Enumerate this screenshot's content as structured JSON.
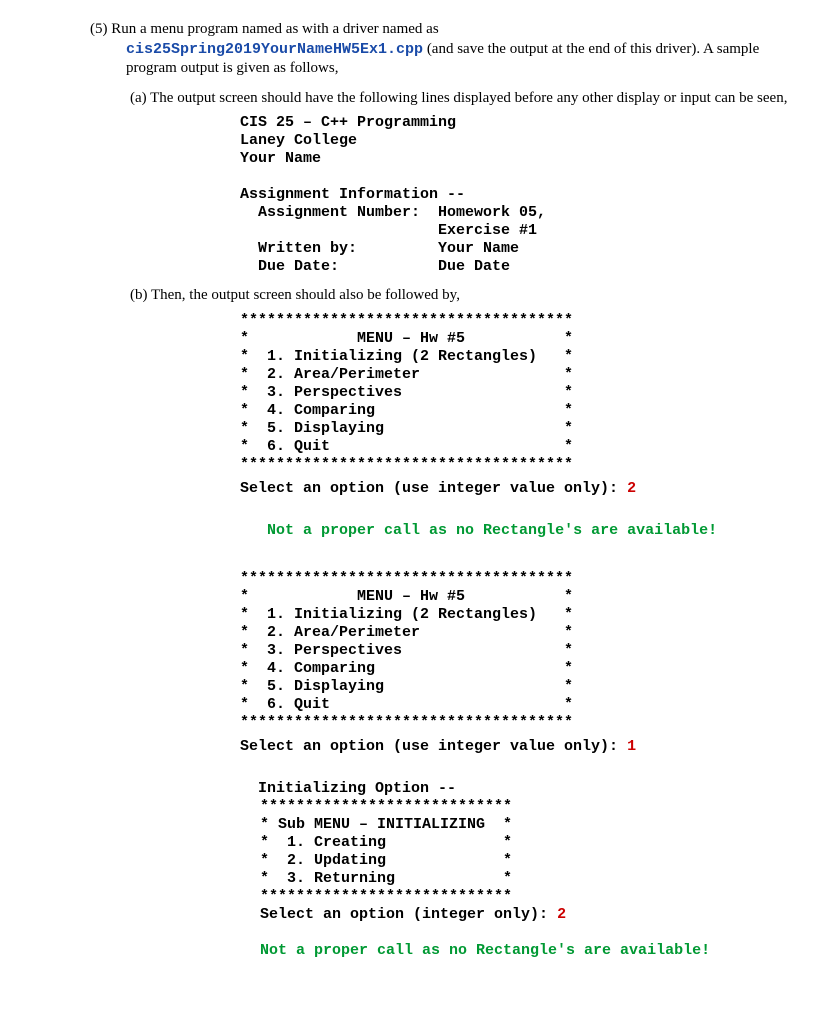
{
  "item5": {
    "label": "(5) ",
    "text1": "Run a menu program named as with a driver named as",
    "filename": "cis25Spring2019YourNameHW5Ex1.cpp",
    "text2": " (and save the output at the end of this driver). A sample program output is given as follows,"
  },
  "sub_a": {
    "label": "(a) ",
    "text": "The output screen should have the following lines displayed before any other display or input can be seen,",
    "output": "CIS 25 – C++ Programming\nLaney College\nYour Name\n\nAssignment Information --\n  Assignment Number:  Homework 05,\n                      Exercise #1\n  Written by:         Your Name\n  Due Date:           Due Date"
  },
  "sub_b": {
    "label": "(b) ",
    "text": "Then, the output screen should also be followed by,",
    "menu1": "*************************************\n*            MENU – Hw #5           *\n*  1. Initializing (2 Rectangles)   *\n*  2. Area/Perimeter                *\n*  3. Perspectives                  *\n*  4. Comparing                     *\n*  5. Displaying                    *\n*  6. Quit                          *\n*************************************",
    "prompt1": "Select an option (use integer value only): ",
    "input1": "2",
    "err1": "Not a proper call as no Rectangle's are available!",
    "menu2": "*************************************\n*            MENU – Hw #5           *\n*  1. Initializing (2 Rectangles)   *\n*  2. Area/Perimeter                *\n*  3. Perspectives                  *\n*  4. Comparing                     *\n*  5. Displaying                    *\n*  6. Quit                          *\n*************************************",
    "prompt2": "Select an option (use integer value only): ",
    "input2": "1",
    "init_label": "Initializing Option --",
    "submenu": "****************************\n* Sub MENU – INITIALIZING  *\n*  1. Creating             *\n*  2. Updating             *\n*  3. Returning            *\n****************************",
    "subprompt": "Select an option (integer only): ",
    "subinput": "2",
    "suberr": "Not a proper call as no Rectangle's are available!"
  }
}
